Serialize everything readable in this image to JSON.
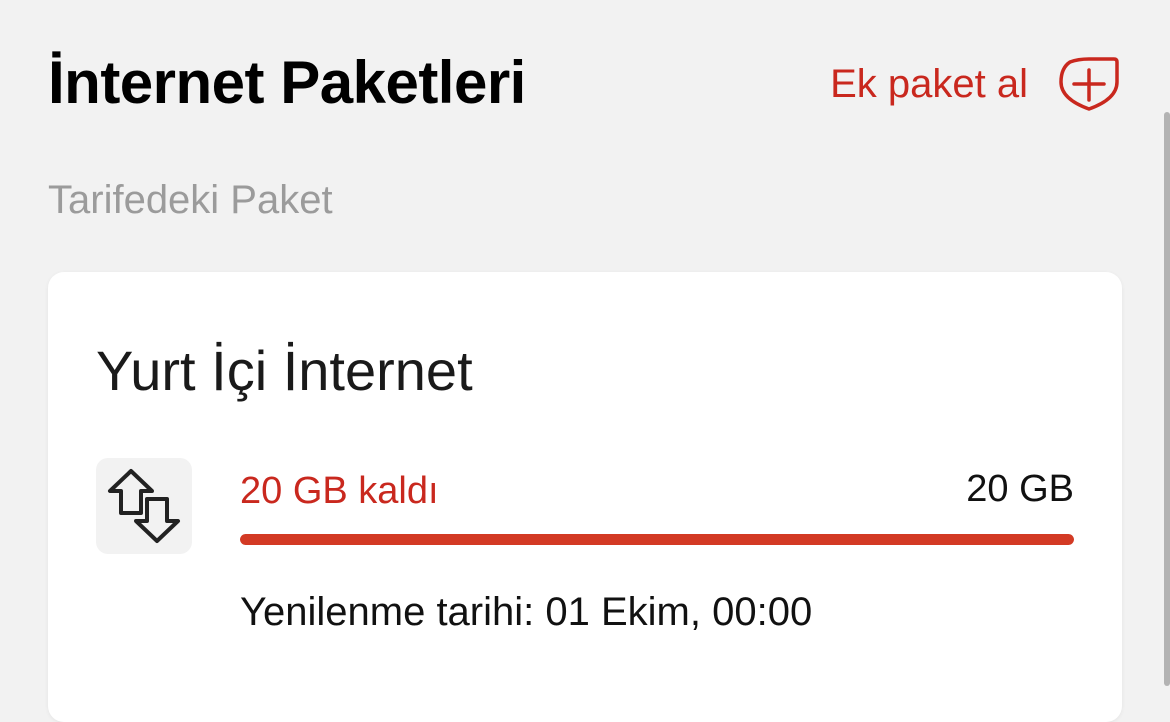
{
  "header": {
    "title": "İnternet Paketleri",
    "add_package_label": "Ek paket al",
    "add_icon": "plus-shield-icon"
  },
  "section": {
    "label": "Tarifedeki Paket"
  },
  "package": {
    "title": "Yurt İçi İnternet",
    "icon": "data-transfer-arrows-icon",
    "remaining_text": "20 GB kaldı",
    "total_text": "20 GB",
    "remaining_fraction": 1.0,
    "renewal_text": "Yenilenme tarihi: 01 Ekim, 00:00"
  },
  "colors": {
    "accent": "#c9281e",
    "progress": "#d33a24",
    "background": "#f2f2f2",
    "card": "#ffffff",
    "muted": "#9b9b9b"
  }
}
